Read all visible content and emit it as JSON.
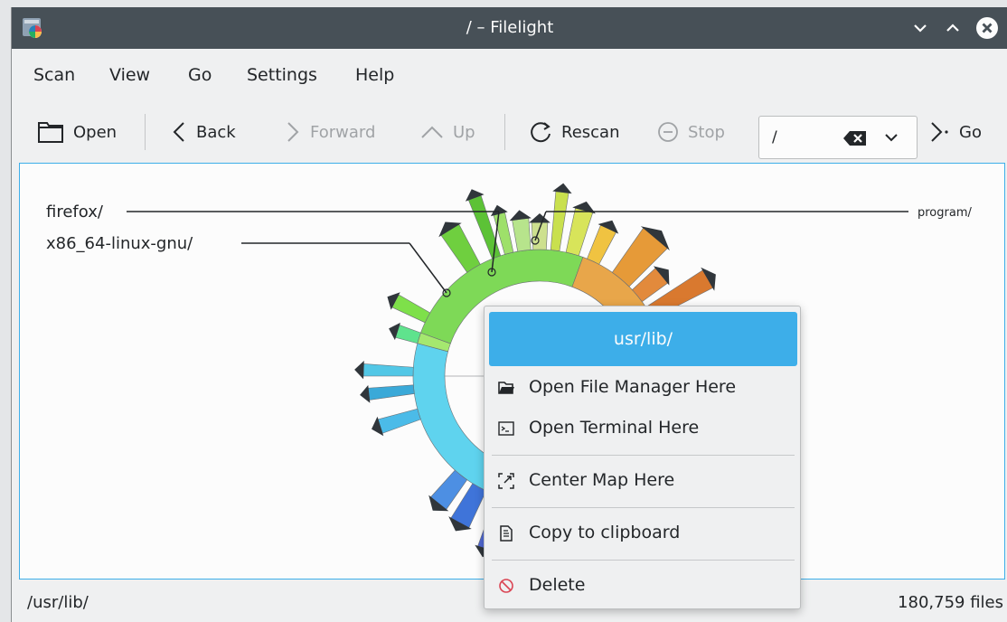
{
  "window": {
    "title": "/ – Filelight"
  },
  "menubar": {
    "items": [
      "Scan",
      "View",
      "Go",
      "Settings",
      "Help"
    ]
  },
  "toolbar": {
    "open": "Open",
    "back": "Back",
    "forward": "Forward",
    "up": "Up",
    "rescan": "Rescan",
    "stop": "Stop",
    "path_value": "/",
    "go": "Go"
  },
  "map": {
    "labels": {
      "firefox": "firefox/",
      "x86": "x86_64-linux-gnu/",
      "program": "program/"
    }
  },
  "context_menu": {
    "header": "usr/lib/",
    "items": [
      {
        "label": "Open File Manager Here",
        "icon": "folder-open-icon"
      },
      {
        "label": "Open Terminal Here",
        "icon": "terminal-icon"
      },
      {
        "label": "Center Map Here",
        "icon": "zoom-fit-icon"
      },
      {
        "label": "Copy to clipboard",
        "icon": "copy-icon"
      },
      {
        "label": "Delete",
        "icon": "delete-icon"
      }
    ]
  },
  "statusbar": {
    "path": "/usr/lib/",
    "files": "180,759 files"
  },
  "colors": {
    "accent": "#3daee9",
    "titlebar": "#475057"
  }
}
